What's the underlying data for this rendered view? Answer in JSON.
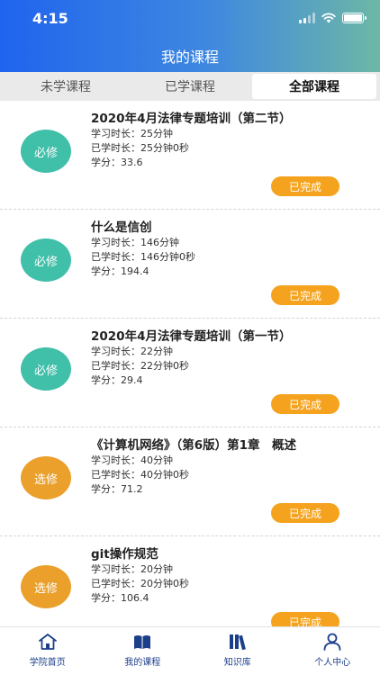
{
  "status_bar": {
    "time": "4:15"
  },
  "header": {
    "title": "我的课程"
  },
  "tabs": [
    {
      "label": "未学课程",
      "active": false
    },
    {
      "label": "已学课程",
      "active": false
    },
    {
      "label": "全部课程",
      "active": true
    }
  ],
  "courses": [
    {
      "type": "必修",
      "title": "2020年4月法律专题培训（第二节）",
      "duration": "学习时长：25分钟",
      "learned": "已学时长：25分钟0秒",
      "credit": "学分：33.6",
      "status": "已完成"
    },
    {
      "type": "必修",
      "title": "什么是信创",
      "duration": "学习时长：146分钟",
      "learned": "已学时长：146分钟0秒",
      "credit": "学分：194.4",
      "status": "已完成"
    },
    {
      "type": "必修",
      "title": "2020年4月法律专题培训（第一节）",
      "duration": "学习时长：22分钟",
      "learned": "已学时长：22分钟0秒",
      "credit": "学分：29.4",
      "status": "已完成"
    },
    {
      "type": "选修",
      "title": "《计算机网络》（第6版）第1章　概述",
      "duration": "学习时长：40分钟",
      "learned": "已学时长：40分钟0秒",
      "credit": "学分：71.2",
      "status": "已完成"
    },
    {
      "type": "选修",
      "title": "git操作规范",
      "duration": "学习时长：20分钟",
      "learned": "已学时长：20分钟0秒",
      "credit": "学分：106.4",
      "status": "已完成"
    }
  ],
  "bottom_nav": [
    {
      "label": "学院首页",
      "icon": "home-icon"
    },
    {
      "label": "我的课程",
      "icon": "book-icon"
    },
    {
      "label": "知识库",
      "icon": "library-icon"
    },
    {
      "label": "个人中心",
      "icon": "user-icon"
    }
  ],
  "colors": {
    "required_badge": "#40bfa9",
    "elective_badge": "#eaa02b",
    "status_button": "#f5a31e",
    "nav_accent": "#1c3f8a"
  }
}
